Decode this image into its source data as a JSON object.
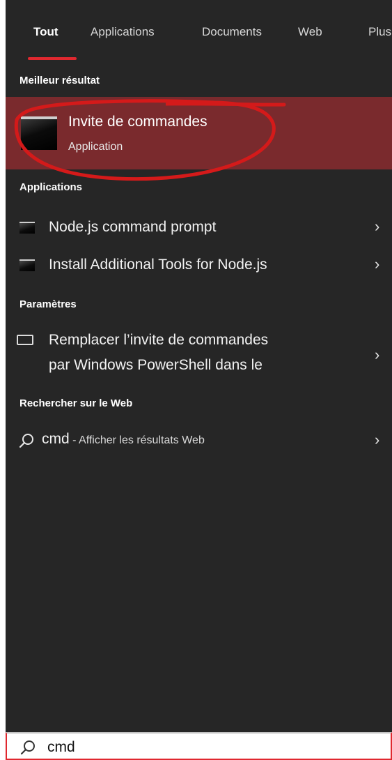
{
  "tabs": [
    {
      "label": "Tout",
      "active": true
    },
    {
      "label": "Applications"
    },
    {
      "label": "Documents"
    },
    {
      "label": "Web"
    },
    {
      "label": "Plus"
    }
  ],
  "sections": {
    "best": "Meilleur résultat",
    "apps": "Applications",
    "settings": "Paramètres",
    "web": "Rechercher sur le Web"
  },
  "best_match": {
    "title": "Invite de commandes",
    "subtitle": "Application",
    "icon": "cmd-icon"
  },
  "apps": [
    {
      "label": "Node.js command prompt",
      "icon": "cmd-icon"
    },
    {
      "label": "Install Additional Tools for Node.js",
      "icon": "cmd-icon"
    }
  ],
  "settings": {
    "line1": "Remplacer l’invite de commandes",
    "line2": "par Windows PowerShell dans le",
    "icon": "monitor-icon"
  },
  "web": {
    "query": "cmd",
    "suffix": " - Afficher les résultats Web",
    "icon": "search-icon"
  },
  "search": {
    "value": "cmd",
    "icon": "search-icon"
  },
  "colors": {
    "panel": "#262626",
    "selected": "#7a2a2d",
    "accent": "#e0282f",
    "annotation": "#d41a1a"
  }
}
